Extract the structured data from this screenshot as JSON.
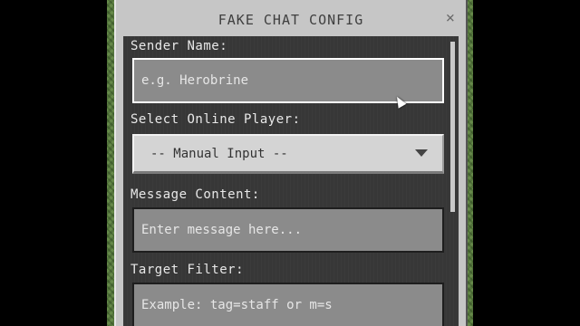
{
  "dialog": {
    "title": "FAKE CHAT CONFIG",
    "close_label": "×"
  },
  "form": {
    "sender_name": {
      "label": "Sender Name:",
      "placeholder": "e.g. Herobrine"
    },
    "online_player": {
      "label": "Select Online Player:",
      "selected": "-- Manual Input --"
    },
    "message_content": {
      "label": "Message Content:",
      "placeholder": "Enter message here..."
    },
    "target_filter": {
      "label": "Target Filter:",
      "placeholder": "Example: tag=staff or m=s"
    }
  },
  "icons": {
    "close": "close-icon",
    "dropdown": "chevron-down-icon",
    "cursor": "mouse-cursor-icon"
  },
  "colors": {
    "panel_bg": "#373737",
    "dialog_bg": "#c6c6c6",
    "field_bg": "#8b8b8b",
    "select_bg": "#d4d4d4",
    "active_border": "#ffffff",
    "backdrop_green": "#5e7f46"
  }
}
